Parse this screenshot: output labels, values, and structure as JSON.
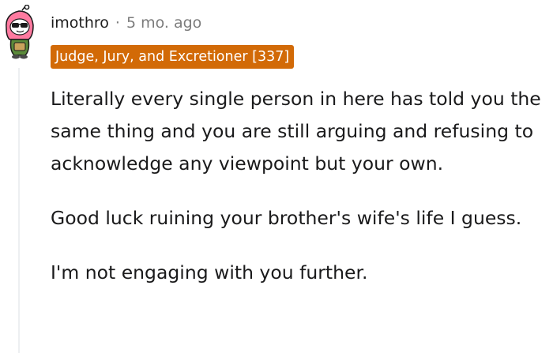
{
  "colors": {
    "flair_background": "#d26a07",
    "meta_text": "#7c7c7c",
    "thread_line": "#edeff1"
  },
  "comment": {
    "avatar_icon": "snoo-avatar-icon",
    "username": "imothro",
    "separator": "·",
    "timestamp": "5 mo. ago",
    "flair": "Judge, Jury, and Excretioner [337]",
    "paragraphs": [
      "Literally every single person in here has told you the same thing and you are still arguing and refusing to acknowledge any viewpoint but your own.",
      "Good luck ruining your brother's wife's life I guess.",
      "I'm not engaging with you further."
    ]
  }
}
